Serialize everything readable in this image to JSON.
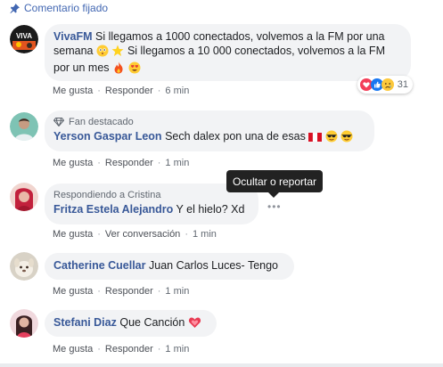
{
  "pinned": {
    "label": "Comentario fijado",
    "icon": "pin-icon",
    "color": "#4267b2"
  },
  "comments": [
    {
      "author": "VivaFM",
      "text_part1": "Si llegamos a 1000 conectados, volvemos a la FM por una semana",
      "text_part2": "Si llegamos a 10 000 conectados, volvemos a la FM por un mes",
      "like": "Me gusta",
      "reply": "Responder",
      "time": "6 min",
      "reactions_count": "31"
    },
    {
      "badge": "Fan destacado",
      "author": "Yerson Gaspar Leon",
      "text": "Sech dalex pon una de esas",
      "like": "Me gusta",
      "reply": "Responder",
      "time": "1 min"
    },
    {
      "replying_to": "Respondiendo a Cristina",
      "author": "Fritza Estela Alejandro",
      "text": "Y el hielo? Xd",
      "like": "Me gusta",
      "view": "Ver conversación",
      "time": "1 min"
    },
    {
      "author": "Catherine Cuellar",
      "text": "Juan Carlos Luces- Tengo",
      "like": "Me gusta",
      "reply": "Responder",
      "time": "1 min"
    },
    {
      "author": "Stefani Diaz",
      "text": "Que Canción",
      "like": "Me gusta",
      "reply": "Responder",
      "time": "1 min"
    }
  ],
  "tooltip": {
    "label": "Ocultar o reportar"
  },
  "colors": {
    "link": "#385898",
    "bubble": "#f2f3f5",
    "meta": "#606770"
  }
}
